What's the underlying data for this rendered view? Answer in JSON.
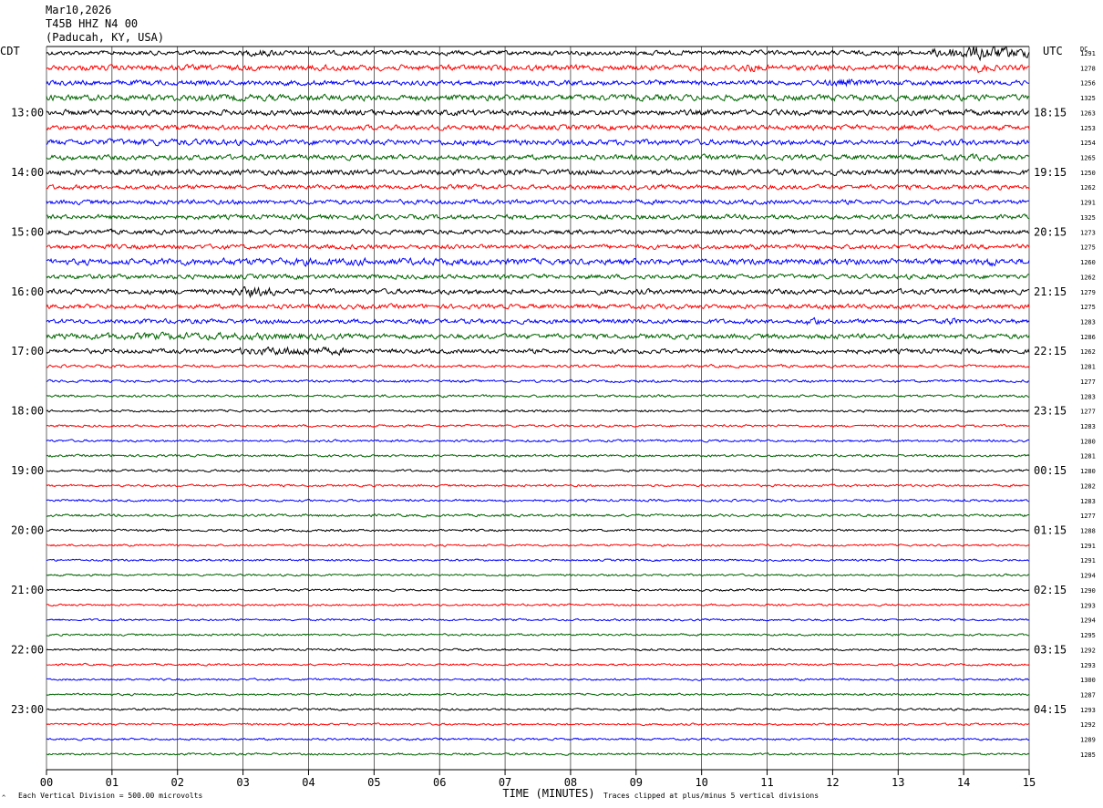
{
  "header": {
    "date": "Mar10,2026",
    "station": "T45B HHZ N4 00",
    "location": "(Paducah, KY, USA)"
  },
  "labels": {
    "left_tz": "CDT",
    "right_tz": "UTC",
    "dc_title": "DC",
    "xlabel": "TIME (MINUTES)",
    "scale_note": "Each Vertical Division =  500.00 microvolts",
    "clip_note": "Traces clipped at plus/minus 5 vertical divisions"
  },
  "chart_data": {
    "type": "line",
    "title": "Mar10,2026 T45B HHZ N4 00 (Paducah, KY, USA)",
    "xlabel": "TIME (MINUTES)",
    "xlim": [
      0,
      15
    ],
    "x_ticks": [
      "00",
      "01",
      "02",
      "03",
      "04",
      "05",
      "06",
      "07",
      "08",
      "09",
      "10",
      "11",
      "12",
      "13",
      "14",
      "15"
    ],
    "left_time_labels": [
      "13:00",
      "14:00",
      "15:00",
      "16:00",
      "17:00",
      "18:00",
      "19:00",
      "20:00",
      "21:00",
      "22:00",
      "23:00"
    ],
    "right_time_labels": [
      "18:15",
      "19:15",
      "20:15",
      "21:15",
      "22:15",
      "23:15",
      "00:15",
      "01:15",
      "02:15",
      "03:15",
      "04:15"
    ],
    "trace_colors": [
      "#000000",
      "#ff0000",
      "#0000ff",
      "#006400"
    ],
    "dc_offsets": [
      1291,
      1278,
      1256,
      1325,
      1263,
      1253,
      1254,
      1265,
      1250,
      1262,
      1291,
      1325,
      1273,
      1275,
      1260,
      1262,
      1279,
      1275,
      1283,
      1286,
      1262,
      1281,
      1277,
      1283,
      1277,
      1283,
      1280,
      1281,
      1280,
      1282,
      1283,
      1277,
      1288,
      1291,
      1291,
      1294,
      1290,
      1293,
      1294,
      1295,
      1292,
      1293,
      1300,
      1287,
      1293,
      1292,
      1289,
      1285
    ],
    "trace_activity": [
      1.0,
      1.2,
      1.1,
      1.3,
      1.2,
      1.1,
      1.2,
      1.1,
      1.2,
      1.0,
      1.0,
      1.0,
      1.0,
      1.0,
      1.3,
      1.0,
      1.1,
      1.0,
      1.0,
      1.1,
      1.0,
      0.6,
      0.55,
      0.55,
      0.5,
      0.5,
      0.5,
      0.5,
      0.5,
      0.5,
      0.5,
      0.55,
      0.5,
      0.45,
      0.45,
      0.45,
      0.45,
      0.45,
      0.45,
      0.45,
      0.45,
      0.45,
      0.45,
      0.45,
      0.45,
      0.45,
      0.45,
      0.45
    ],
    "events": [
      {
        "trace": 0,
        "start": 13.5,
        "end": 15.0,
        "amp": 3.2
      },
      {
        "trace": 0,
        "start": 3.0,
        "end": 3.6,
        "amp": 1.6
      },
      {
        "trace": 1,
        "start": 10.5,
        "end": 10.9,
        "amp": 2.0
      },
      {
        "trace": 1,
        "start": 4.0,
        "end": 4.6,
        "amp": 1.6
      },
      {
        "trace": 1,
        "start": 14.1,
        "end": 14.4,
        "amp": 2.2
      },
      {
        "trace": 2,
        "start": 11.9,
        "end": 12.5,
        "amp": 1.8
      },
      {
        "trace": 3,
        "start": 2.0,
        "end": 3.5,
        "amp": 1.5
      },
      {
        "trace": 6,
        "start": 0.5,
        "end": 2.8,
        "amp": 1.5
      },
      {
        "trace": 7,
        "start": 13.7,
        "end": 14.6,
        "amp": 1.4
      },
      {
        "trace": 8,
        "start": 0.0,
        "end": 1.5,
        "amp": 1.3
      },
      {
        "trace": 14,
        "start": 1.5,
        "end": 7.0,
        "amp": 1.6
      },
      {
        "trace": 14,
        "start": 14.3,
        "end": 14.5,
        "amp": 2.4
      },
      {
        "trace": 16,
        "start": 2.8,
        "end": 3.5,
        "amp": 2.3
      },
      {
        "trace": 18,
        "start": 11.6,
        "end": 11.8,
        "amp": 2.2
      },
      {
        "trace": 18,
        "start": 13.7,
        "end": 13.9,
        "amp": 2.0
      },
      {
        "trace": 19,
        "start": 0.1,
        "end": 4.5,
        "amp": 1.6
      },
      {
        "trace": 20,
        "start": 2.9,
        "end": 4.6,
        "amp": 2.0
      }
    ],
    "amplitude_px": 3.6
  }
}
